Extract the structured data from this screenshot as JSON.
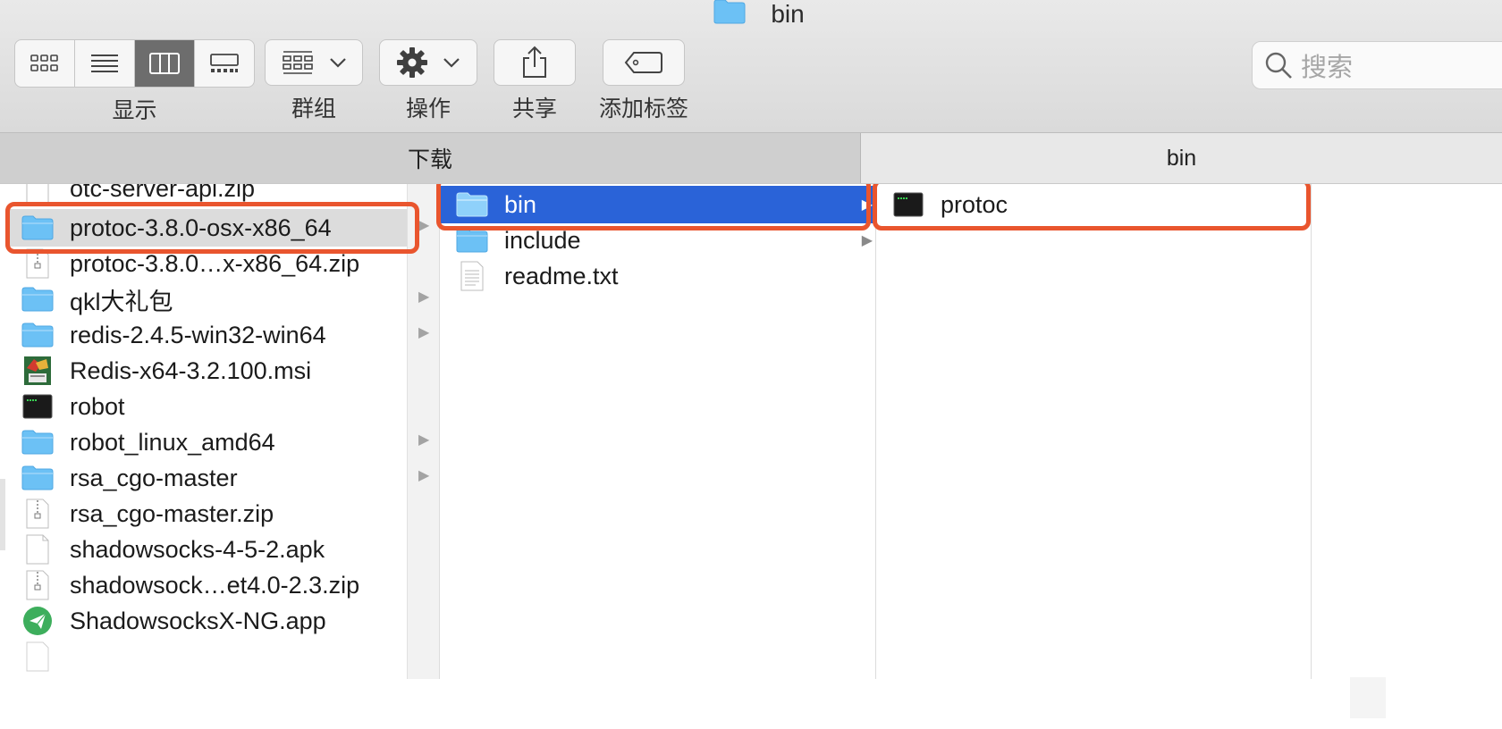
{
  "window": {
    "title": "bin",
    "title_icon": "folder-icon"
  },
  "toolbar": {
    "view_label": "显示",
    "view_modes": [
      "icon-view-icon",
      "list-view-icon",
      "column-view-icon",
      "gallery-view-icon"
    ],
    "active_view": "column-view-icon",
    "group_label": "群组",
    "action_label": "操作",
    "share_label": "共享",
    "tag_label": "添加标签"
  },
  "search": {
    "placeholder": "搜索"
  },
  "column_headers": {
    "left": "下载",
    "right": "bin"
  },
  "columns": {
    "downloads": {
      "partial_top": "otc-server-api.zip",
      "items": [
        {
          "name": "protoc-3.8.0-osx-x86_64",
          "icon": "folder-icon",
          "selected": true
        },
        {
          "name": "protoc-3.8.0…x-x86_64.zip",
          "icon": "zip-icon"
        },
        {
          "name": "qkl大礼包",
          "icon": "folder-icon"
        },
        {
          "name": "redis-2.4.5-win32-win64",
          "icon": "folder-icon"
        },
        {
          "name": "Redis-x64-3.2.100.msi",
          "icon": "msi-installer-icon"
        },
        {
          "name": "robot",
          "icon": "executable-icon"
        },
        {
          "name": "robot_linux_amd64",
          "icon": "folder-icon"
        },
        {
          "name": "rsa_cgo-master",
          "icon": "folder-icon"
        },
        {
          "name": "rsa_cgo-master.zip",
          "icon": "zip-icon"
        },
        {
          "name": "shadowsocks-4-5-2.apk",
          "icon": "document-icon"
        },
        {
          "name": "shadowsock…et4.0-2.3.zip",
          "icon": "zip-icon"
        },
        {
          "name": "ShadowsocksX-NG.app",
          "icon": "paper-plane-app-icon"
        }
      ]
    },
    "protoc": {
      "items": [
        {
          "name": "bin",
          "icon": "folder-icon",
          "selected": true
        },
        {
          "name": "include",
          "icon": "folder-icon"
        },
        {
          "name": "readme.txt",
          "icon": "text-file-icon"
        }
      ]
    },
    "bin": {
      "items": [
        {
          "name": "protoc",
          "icon": "executable-icon"
        }
      ]
    }
  },
  "colors": {
    "selection_blue": "#2a63d8",
    "selection_gray": "#dcdcdc",
    "highlight_outline": "#e9552e",
    "folder_blue": "#6cc1f5"
  }
}
